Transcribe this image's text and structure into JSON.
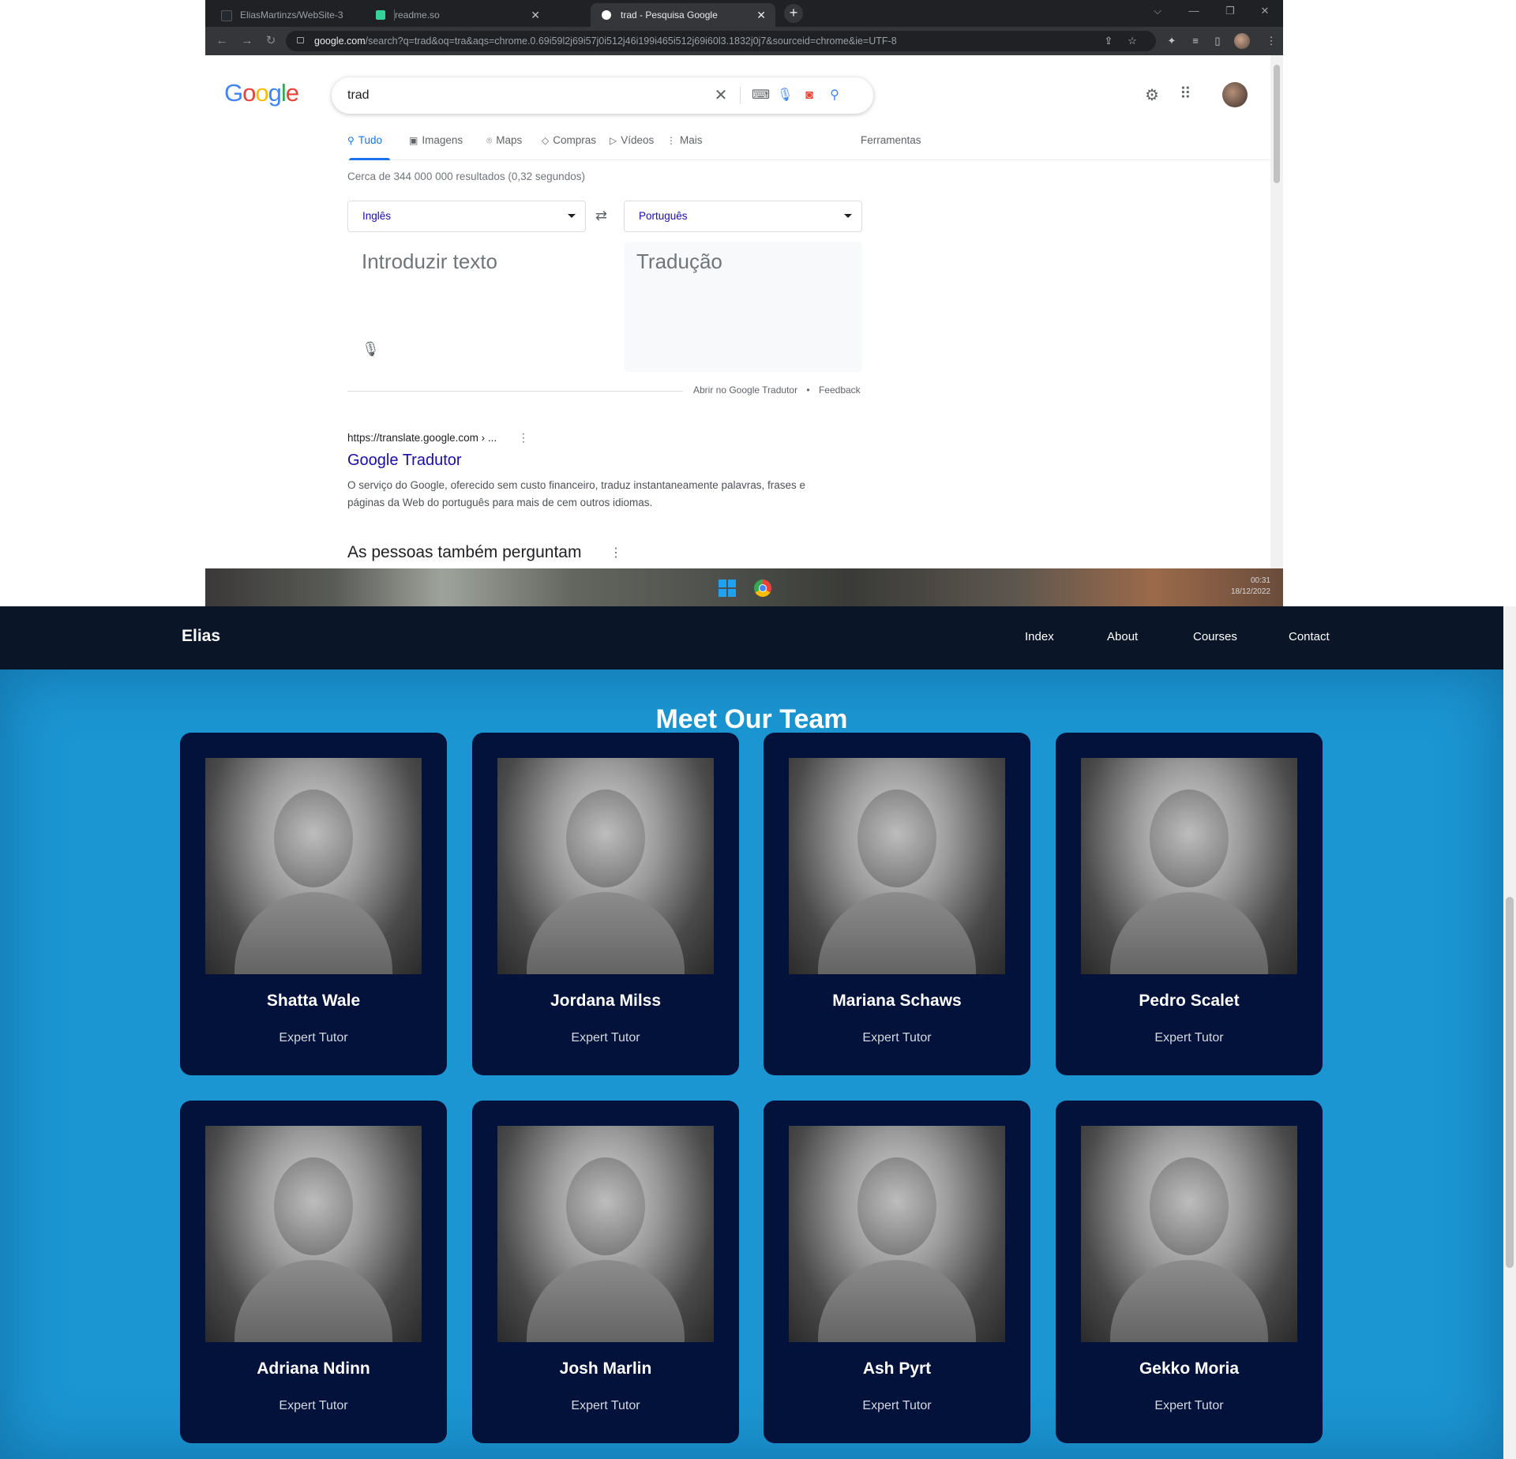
{
  "browser": {
    "tabs": [
      {
        "title": "EliasMartinzs/WebSite-3",
        "active": false,
        "favicon_color": "#24292f"
      },
      {
        "title": "readme.so",
        "active": false,
        "favicon_color": "#34d399"
      },
      {
        "title": "trad - Pesquisa Google",
        "active": true,
        "favicon_color": "#ffffff"
      }
    ],
    "new_tab_label": "+",
    "window_controls": {
      "chevron": "⌵",
      "minimize": "—",
      "restore": "❐",
      "close": "✕"
    },
    "url": {
      "domain": "google.com",
      "rest": "/search?q=trad&oq=tra&aqs=chrome.0.69i59l2j69i57j0i512j46i199i465i512j69i60l3.1832j0j7&sourceid=chrome&ie=UTF-8"
    }
  },
  "google": {
    "logo": "Google",
    "query": "trad",
    "tabs": [
      {
        "label": "Tudo",
        "icon": "search-icon",
        "active": true
      },
      {
        "label": "Imagens",
        "icon": "image-icon",
        "active": false
      },
      {
        "label": "Maps",
        "icon": "map-pin-icon",
        "active": false
      },
      {
        "label": "Compras",
        "icon": "tag-icon",
        "active": false
      },
      {
        "label": "Vídeos",
        "icon": "video-icon",
        "active": false
      },
      {
        "label": "Mais",
        "icon": "more-vert-icon",
        "active": false
      }
    ],
    "tools_label": "Ferramentas",
    "result_stats": "Cerca de 344 000 000 resultados (0,32 segundos)",
    "translate": {
      "source_lang": "Inglês",
      "target_lang": "Português",
      "source_placeholder": "Introduzir texto",
      "target_placeholder": "Tradução",
      "open_link": "Abrir no Google Tradutor",
      "separator": "•",
      "feedback": "Feedback"
    },
    "result": {
      "cite": "https://translate.google.com › ...",
      "title": "Google Tradutor",
      "snippet": "O serviço do Google, oferecido sem custo financeiro, traduz instantaneamente palavras, frases e páginas da Web do português para mais de cem outros idiomas."
    },
    "people_also_ask": "As pessoas também perguntam"
  },
  "taskbar": {
    "time": "00:31",
    "date": "18/12/2022"
  },
  "site": {
    "brand": "Elias",
    "nav": [
      "Index",
      "About",
      "Courses",
      "Contact"
    ],
    "section_title": "Meet Our Team",
    "team": [
      {
        "name": "Shatta Wale",
        "role": "Expert Tutor"
      },
      {
        "name": "Jordana Milss",
        "role": "Expert Tutor"
      },
      {
        "name": "Mariana Schaws",
        "role": "Expert Tutor"
      },
      {
        "name": "Pedro Scalet",
        "role": "Expert Tutor"
      },
      {
        "name": "Adriana Ndinn",
        "role": "Expert Tutor"
      },
      {
        "name": "Josh Marlin",
        "role": "Expert Tutor"
      },
      {
        "name": "Ash Pyrt",
        "role": "Expert Tutor"
      },
      {
        "name": "Gekko Moria",
        "role": "Expert Tutor"
      }
    ],
    "colors": {
      "nav_bg": "#0a1628",
      "section_bg": "#1b96d2",
      "card_bg": "#02123a"
    }
  }
}
